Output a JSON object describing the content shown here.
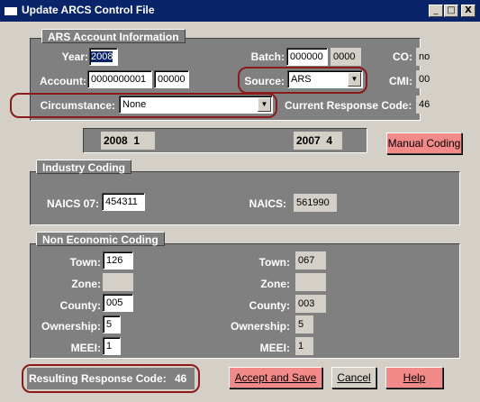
{
  "window": {
    "title": "Update ARCS Control File",
    "minimize": "_",
    "maximize": "□",
    "close": "X"
  },
  "ars": {
    "title": "ARS Account Information",
    "year_label": "Year:",
    "year_value": "2008",
    "batch_label": "Batch:",
    "batch_value": "000000",
    "batch_suffix": "0000",
    "co_label": "CO:",
    "co_value": "no",
    "account_label": "Account:",
    "account_value": "0000000001",
    "account_suffix": "00000",
    "source_label": "Source:",
    "source_value": "ARS",
    "cmi_label": "CMI:",
    "cmi_value": "00",
    "circumstance_label": "Circumstance:",
    "circumstance_value": "None",
    "crc_label": "Current Response Code:",
    "crc_value": "46"
  },
  "years": {
    "left_year": "2008",
    "left_count": "1",
    "right_year": "2007",
    "right_count": "4"
  },
  "buttons": {
    "manual_coding": "Manual Coding",
    "accept_save": "Accept and Save",
    "cancel": "Cancel",
    "help": "Help"
  },
  "industry": {
    "title": "Industry Coding",
    "naics07_label": "NAICS 07:",
    "naics07_value": "454311",
    "naics_label": "NAICS:",
    "naics_value": "561990"
  },
  "noneco": {
    "title": "Non Economic Coding",
    "town_label": "Town:",
    "zone_label": "Zone:",
    "county_label": "County:",
    "ownership_label": "Ownership:",
    "meei_label": "MEEI:",
    "left": {
      "town": "126",
      "zone": "",
      "county": "005",
      "ownership": "5",
      "meei": "1"
    },
    "right": {
      "town": "067",
      "zone": "",
      "county": "003",
      "ownership": "5",
      "meei": "1"
    }
  },
  "resulting": {
    "label": "Resulting Response Code:",
    "value": "46"
  }
}
